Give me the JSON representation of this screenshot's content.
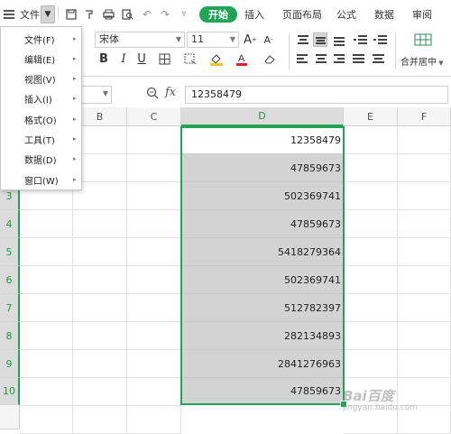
{
  "topbar": {
    "file_label": "文件",
    "tabs": [
      "开始",
      "插入",
      "页面布局",
      "公式",
      "数据",
      "审阅"
    ]
  },
  "ribbon": {
    "font_name": "宋体",
    "font_size": "11",
    "merge_label": "合并居中"
  },
  "formula_bar": {
    "value": "12358479"
  },
  "sheet": {
    "columns": [
      "B",
      "C",
      "D",
      "E",
      "F"
    ],
    "rows": [
      "3",
      "4",
      "5",
      "6",
      "7",
      "8",
      "9",
      "10"
    ],
    "d_values": [
      "12358479",
      "47859673",
      "502369741",
      "47859673",
      "5418279364",
      "502369741",
      "512782397",
      "282134893",
      "2841276963",
      "47859673"
    ]
  },
  "file_menu": {
    "items": [
      "文件(F)",
      "编辑(E)",
      "视图(V)",
      "插入(I)",
      "格式(O)",
      "工具(T)",
      "数据(D)",
      "窗口(W)"
    ]
  },
  "watermark": {
    "text": "Bai百度",
    "sub": "jingyan.baidu.com"
  },
  "colors": {
    "accent": "#23a357",
    "selection_fill": "#d3d3d3"
  }
}
